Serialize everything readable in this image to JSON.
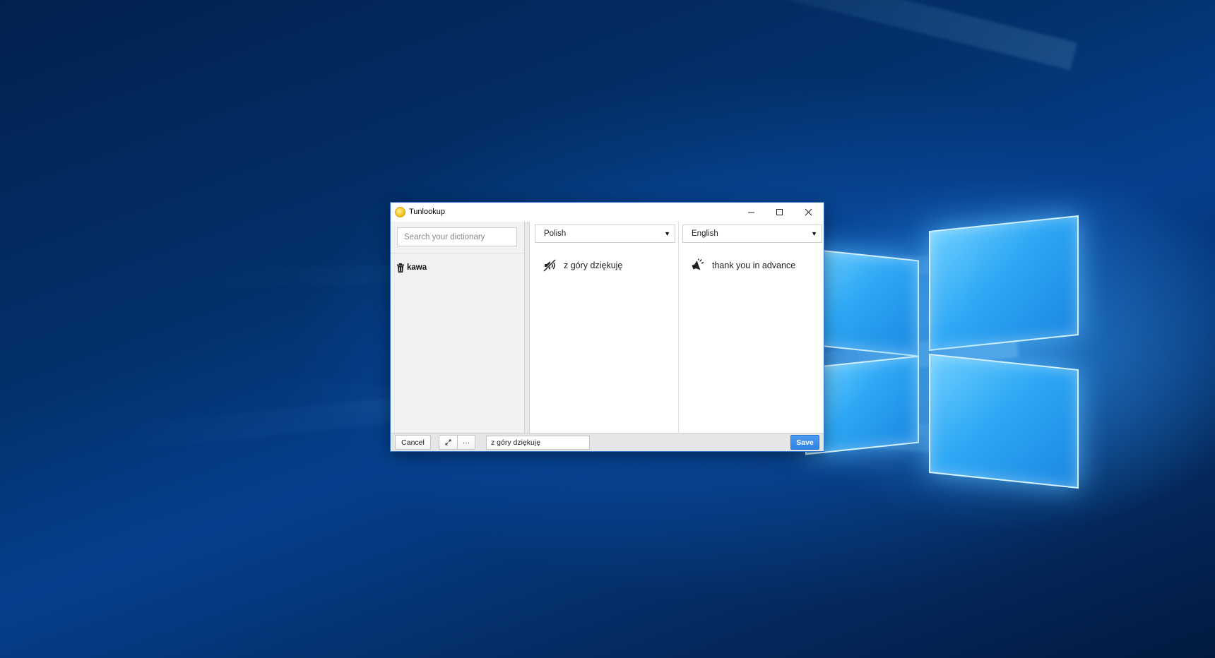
{
  "window": {
    "title": "Tunlookup",
    "controls": {
      "minimize_icon": "minimize-icon",
      "maximize_icon": "maximize-icon",
      "close_icon": "close-icon"
    }
  },
  "sidebar": {
    "search": {
      "placeholder": "Search your dictionary",
      "value": ""
    },
    "entries": [
      {
        "label": "kawa",
        "icon": "trash-icon"
      }
    ]
  },
  "panes": {
    "source": {
      "language": "Polish",
      "phrase": "z góry dziękuję",
      "audio_icon": "speaker-muted-icon"
    },
    "target": {
      "language": "English",
      "phrase": "thank you in advance",
      "audio_icon": "speaker-icon"
    }
  },
  "bottombar": {
    "cancel_label": "Cancel",
    "expand_icon": "expand-icon",
    "more_label": "···",
    "phrase_value": "z góry dziękuję",
    "save_label": "Save"
  },
  "colors": {
    "accent": "#2f82e6",
    "desktop_background": "#063f8c"
  }
}
